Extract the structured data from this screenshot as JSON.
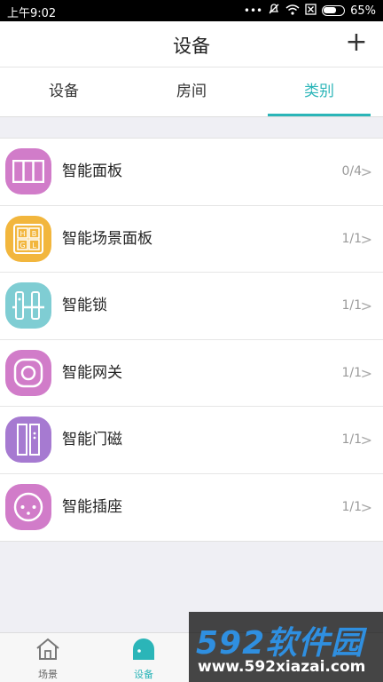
{
  "status_bar": {
    "time": "上午9:02",
    "dots": "•••",
    "battery_percent": "65%",
    "battery_level": 0.65
  },
  "header": {
    "title": "设备",
    "add_label": "+"
  },
  "tabs": [
    {
      "label": "设备",
      "active": false
    },
    {
      "label": "房间",
      "active": false
    },
    {
      "label": "类别",
      "active": true
    }
  ],
  "categories": [
    {
      "label": "智能面板",
      "count": "0/4",
      "color": "#d17cc9",
      "icon": "panel-icon"
    },
    {
      "label": "智能场景面板",
      "count": "1/1",
      "color": "#f2b63d",
      "icon": "scene-panel-icon",
      "keys": [
        "H",
        "B",
        "G",
        "L"
      ]
    },
    {
      "label": "智能锁",
      "count": "1/1",
      "color": "#7fcdd3",
      "icon": "lock-icon"
    },
    {
      "label": "智能网关",
      "count": "1/1",
      "color": "#d17cc9",
      "icon": "gateway-icon"
    },
    {
      "label": "智能门磁",
      "count": "1/1",
      "color": "#a67ad1",
      "icon": "door-sensor-icon"
    },
    {
      "label": "智能插座",
      "count": "1/1",
      "color": "#d17cc9",
      "icon": "socket-icon"
    }
  ],
  "chevron": ">",
  "bottom_nav": [
    {
      "label": "场景",
      "icon": "home-icon",
      "active": false
    },
    {
      "label": "设备",
      "icon": "device-icon",
      "active": true
    }
  ],
  "watermark": {
    "logo": "592软件园",
    "url": "www.592xiazai.com"
  },
  "colors": {
    "accent": "#2bb5b8"
  }
}
